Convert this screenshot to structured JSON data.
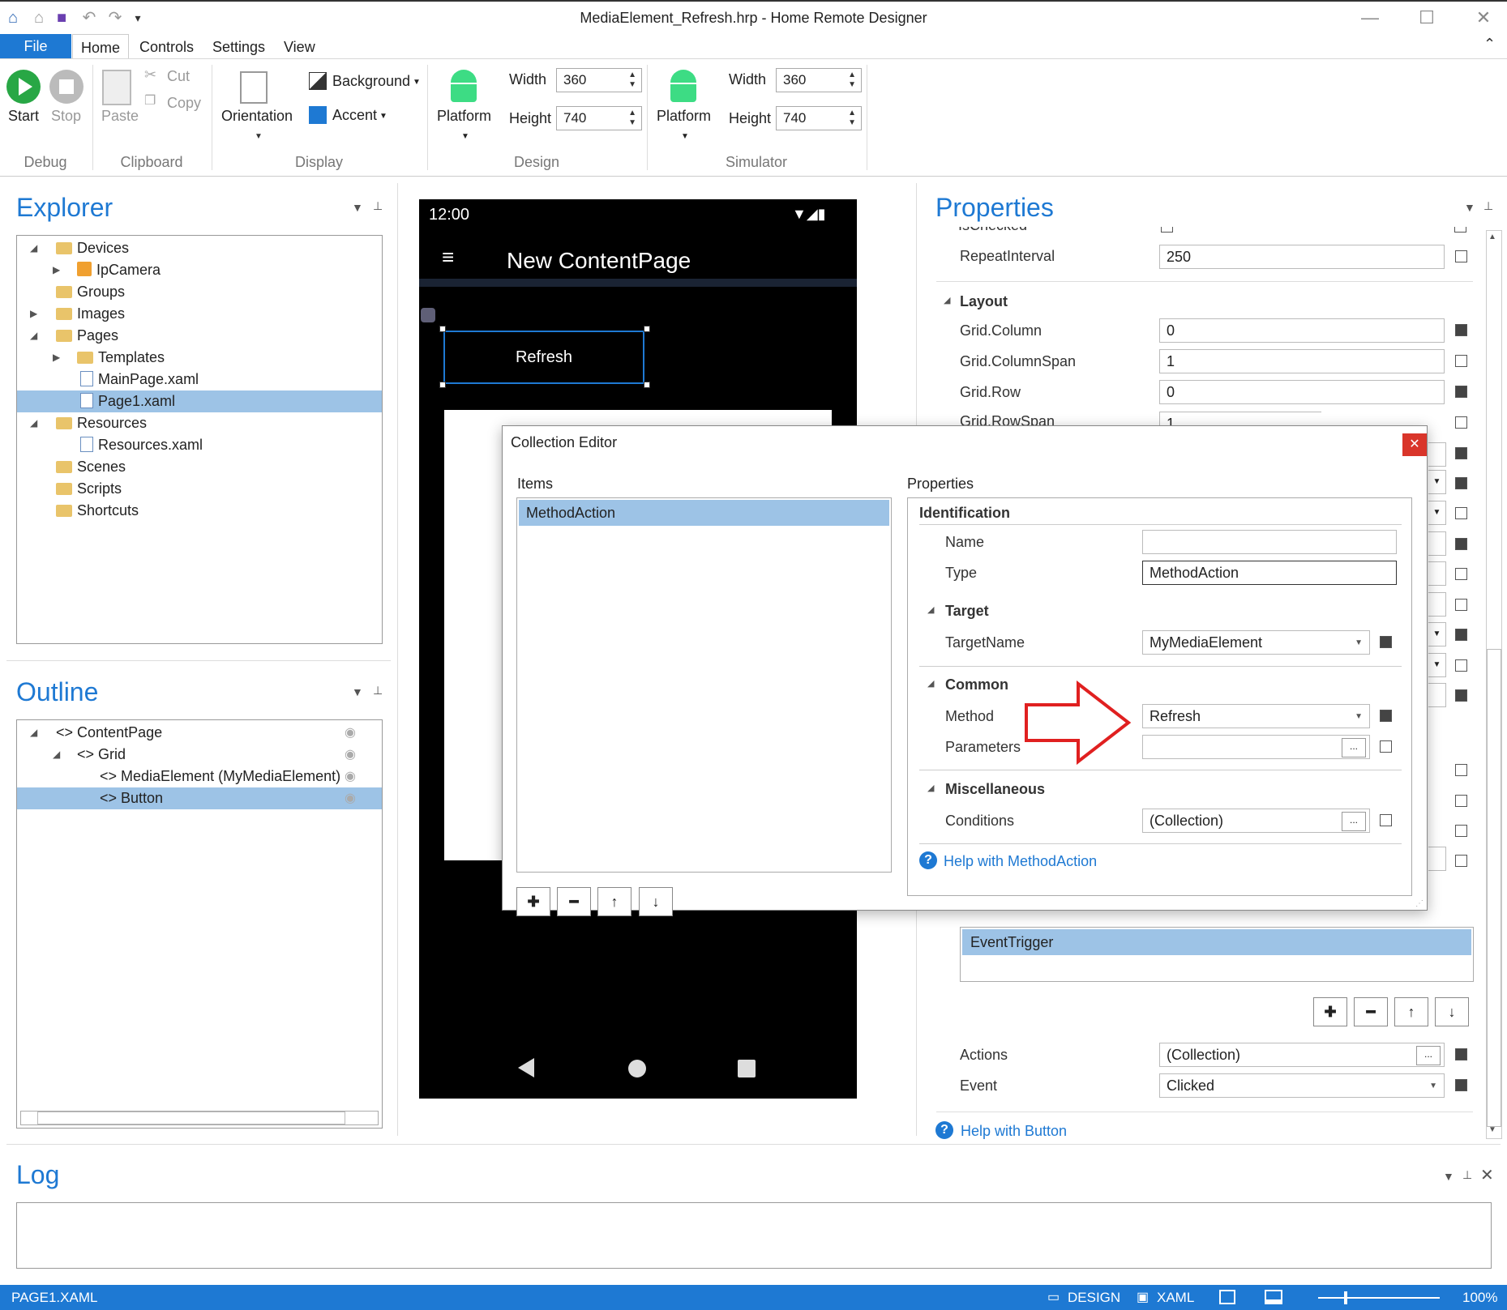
{
  "window": {
    "title": "MediaElement_Refresh.hrp - Home Remote Designer"
  },
  "ribbon_tabs": [
    "File",
    "Home",
    "Controls",
    "Settings",
    "View"
  ],
  "ribbon": {
    "start": "Start",
    "stop": "Stop",
    "paste": "Paste",
    "cut": "Cut",
    "copy": "Copy",
    "orientation": "Orientation",
    "background": "Background",
    "accent": "Accent",
    "platform1": "Platform",
    "platform2": "Platform",
    "width_label1": "Width",
    "height_label1": "Height",
    "width_val1": "360",
    "height_val1": "740",
    "width_label2": "Width",
    "height_label2": "Height",
    "width_val2": "360",
    "height_val2": "740",
    "groups": [
      "Debug",
      "Clipboard",
      "Display",
      "Design",
      "Simulator"
    ]
  },
  "explorer": {
    "title": "Explorer",
    "items": [
      "Devices",
      "IpCamera",
      "Groups",
      "Images",
      "Pages",
      "Templates",
      "MainPage.xaml",
      "Page1.xaml",
      "Resources",
      "Resources.xaml",
      "Scenes",
      "Scripts",
      "Shortcuts"
    ]
  },
  "outline": {
    "title": "Outline",
    "items": [
      "ContentPage",
      "Grid",
      "MediaElement (MyMediaElement)",
      "Button"
    ]
  },
  "phone": {
    "time": "12:00",
    "page_title": "New ContentPage",
    "button": "Refresh"
  },
  "properties": {
    "title": "Properties",
    "partial_top": "IsChecked",
    "repeat_interval_label": "RepeatInterval",
    "repeat_interval": "250",
    "layout_section": "Layout",
    "grid_column_label": "Grid.Column",
    "grid_column": "0",
    "grid_columnspan_label": "Grid.ColumnSpan",
    "grid_columnspan": "1",
    "grid_row_label": "Grid.Row",
    "grid_row": "0",
    "grid_rowspan_label": "Grid.RowSpan",
    "grid_rowspan": "1",
    "trigger_item": "EventTrigger",
    "actions_label": "Actions",
    "actions_value": "(Collection)",
    "event_label": "Event",
    "event_value": "Clicked",
    "help": "Help with Button"
  },
  "dialog": {
    "title": "Collection Editor",
    "items_label": "Items",
    "properties_label": "Properties",
    "list_items": [
      "MethodAction"
    ],
    "identification": "Identification",
    "name_label": "Name",
    "name_value": "",
    "type_label": "Type",
    "type_value": "MethodAction",
    "target_section": "Target",
    "targetname_label": "TargetName",
    "targetname_value": "MyMediaElement",
    "common_section": "Common",
    "method_label": "Method",
    "method_value": "Refresh",
    "parameters_label": "Parameters",
    "parameters_value": "",
    "misc_section": "Miscellaneous",
    "conditions_label": "Conditions",
    "conditions_value": "(Collection)",
    "help": "Help with MethodAction",
    "ellipsis": "..."
  },
  "log": {
    "title": "Log"
  },
  "status": {
    "file": "PAGE1.XAML",
    "design": "DESIGN",
    "xaml": "XAML",
    "zoom": "100%"
  },
  "colors": {
    "accent": "#1e79d3",
    "selection": "#9dc3e6",
    "arrow": "#e02020",
    "close": "#d9352a"
  }
}
